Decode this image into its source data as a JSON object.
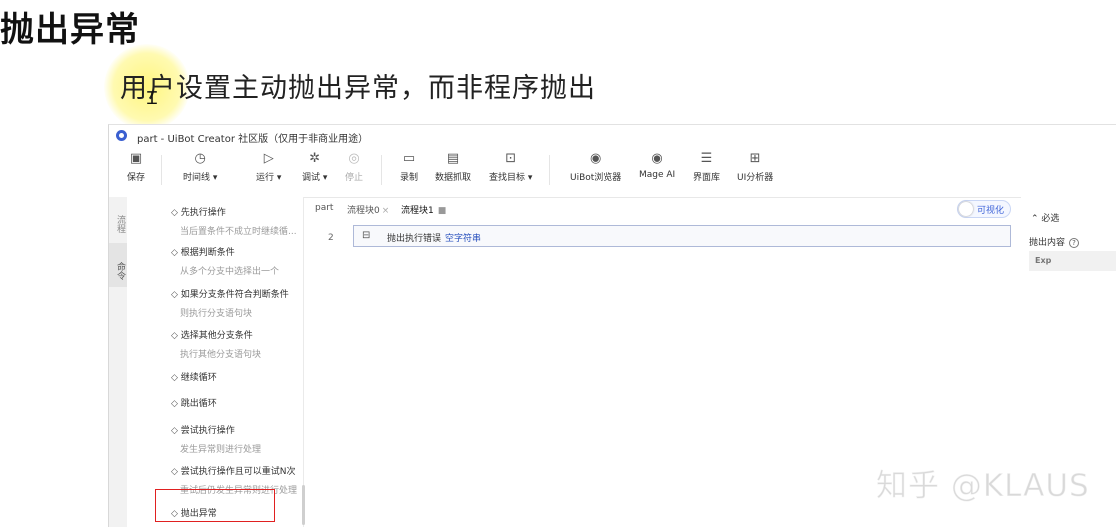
{
  "heading": "抛出异常",
  "subtitle": "用户设置主动抛出异常，而非程序抛出",
  "window": {
    "title": "part - UiBot Creator 社区版（仅用于非商业用途）"
  },
  "toolbar": {
    "save": "保存",
    "timeline": "时间线 ▾",
    "run": "运行 ▾",
    "debug": "调试 ▾",
    "stop": "停止",
    "record": "录制",
    "data_scrape": "数据抓取",
    "find_target": "查找目标 ▾",
    "uibot_browser": "UiBot浏览器",
    "mage_ai": "Mage AI",
    "ui_library": "界面库",
    "ui_analyzer": "UI分析器"
  },
  "left_tabs": {
    "flow": "流程",
    "commands": "命令"
  },
  "commands": [
    {
      "title": "先执行操作",
      "desc": "当后置条件不成立时继续循..."
    },
    {
      "title": "根据判断条件",
      "desc": "从多个分支中选择出一个"
    },
    {
      "title": "如果分支条件符合判断条件",
      "desc": "则执行分支语句块"
    },
    {
      "title": "选择其他分支条件",
      "desc": "执行其他分支语句块"
    },
    {
      "title": "继续循环",
      "desc": ""
    },
    {
      "title": "跳出循环",
      "desc": ""
    },
    {
      "title": "尝试执行操作",
      "desc": "发生异常则进行处理"
    },
    {
      "title": "尝试执行操作且可以重试N次",
      "desc": "重试后仍发生异常则进行处理"
    },
    {
      "title": "抛出异常",
      "desc": ""
    }
  ],
  "tabs": [
    {
      "label": "part"
    },
    {
      "label": "流程块0",
      "close": "×"
    },
    {
      "label": "流程块1",
      "dot": "■"
    }
  ],
  "visual_toggle": "可视化",
  "editor": {
    "line_number": "2",
    "statement": "抛出执行错误",
    "argument": "空字符串"
  },
  "properties": {
    "required": "⌃ 必选",
    "content_label": "抛出内容",
    "help": "?",
    "exp": "Exp"
  },
  "watermark": "知乎 @KLAUS",
  "colors": {
    "accent": "#3e63d8",
    "selection_border": "#e02020"
  }
}
